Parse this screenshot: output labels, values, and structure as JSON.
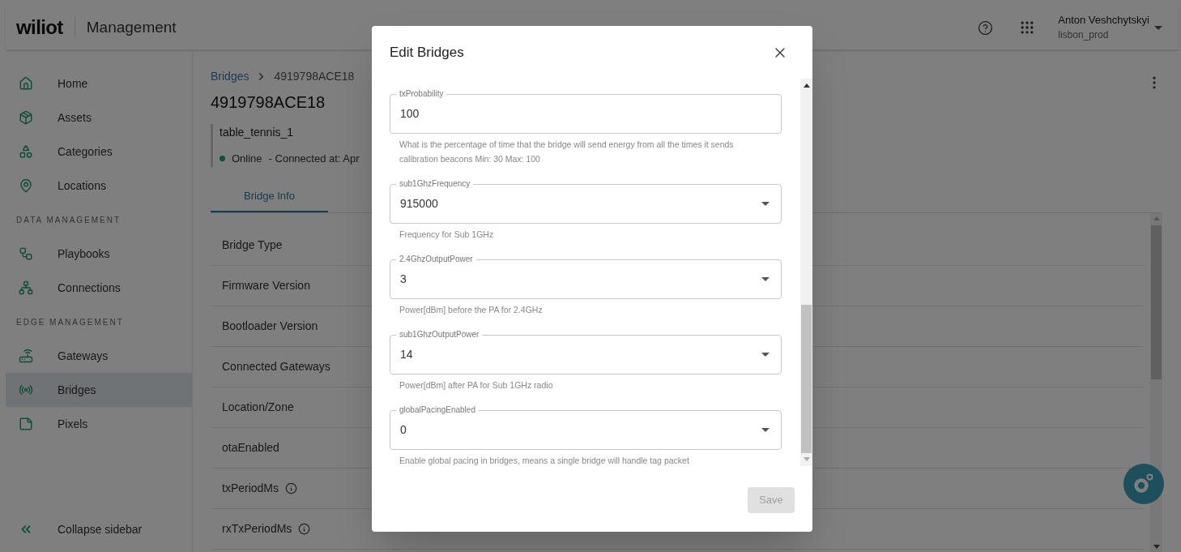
{
  "header": {
    "logo": "wiliot",
    "title": "Management",
    "user": {
      "name": "Anton Veshchytskyi",
      "account": "lisbon_prod"
    }
  },
  "sidebar": {
    "items": [
      {
        "kind": "item",
        "label": "Home",
        "selected": false
      },
      {
        "kind": "item",
        "label": "Assets",
        "selected": false
      },
      {
        "kind": "item",
        "label": "Categories",
        "selected": false
      },
      {
        "kind": "item",
        "label": "Locations",
        "selected": false
      },
      {
        "kind": "section",
        "label": "DATA MANAGEMENT"
      },
      {
        "kind": "item",
        "label": "Playbooks",
        "selected": false
      },
      {
        "kind": "item",
        "label": "Connections",
        "selected": false
      },
      {
        "kind": "section",
        "label": "EDGE MANAGEMENT"
      },
      {
        "kind": "item",
        "label": "Gateways",
        "selected": false
      },
      {
        "kind": "item",
        "label": "Bridges",
        "selected": true
      },
      {
        "kind": "item",
        "label": "Pixels",
        "selected": false
      }
    ],
    "collapse": "Collapse sidebar"
  },
  "breadcrumb": [
    "Bridges",
    "4919798ACE18"
  ],
  "page_title": "4919798ACE18",
  "bridge": {
    "name": "table_tennis_1",
    "status": "Online",
    "online": true,
    "connected": "- Connected at: Apr"
  },
  "tabs": [
    {
      "label": "Bridge Info",
      "selected": true
    }
  ],
  "rows": [
    {
      "label": "Bridge Type",
      "info": false
    },
    {
      "label": "Firmware Version",
      "info": false
    },
    {
      "label": "Bootloader Version",
      "info": false
    },
    {
      "label": "Connected Gateways",
      "info": false
    },
    {
      "label": "Location/Zone",
      "info": false
    },
    {
      "label": "otaEnabled",
      "info": false
    },
    {
      "label": "txPeriodMs",
      "info": true
    },
    {
      "label": "rxTxPeriodMs",
      "info": true
    }
  ],
  "dialog": {
    "title": "Edit Bridges",
    "fields": [
      {
        "kind": "text",
        "label": "txProbability",
        "value": "100",
        "helper": "What is the percentage of time that the bridge will send energy from all the times it sends calibration beacons Min: 30 Max: 100"
      },
      {
        "kind": "select",
        "label": "sub1GhzFrequency",
        "value": "915000",
        "helper": "Frequency for Sub 1GHz"
      },
      {
        "kind": "select",
        "label": "2.4GhzOutputPower",
        "value": "3",
        "helper": "Power[dBm] before the PA for 2.4GHz"
      },
      {
        "kind": "select",
        "label": "sub1GhzOutputPower",
        "value": "14",
        "helper": "Power[dBm] after PA for Sub 1GHz radio"
      },
      {
        "kind": "select",
        "label": "globalPacingEnabled",
        "value": "0",
        "helper": "Enable global pacing in bridges, means a single bridge will handle tag packet"
      }
    ],
    "save": {
      "label": "Save",
      "disabled": true
    }
  }
}
